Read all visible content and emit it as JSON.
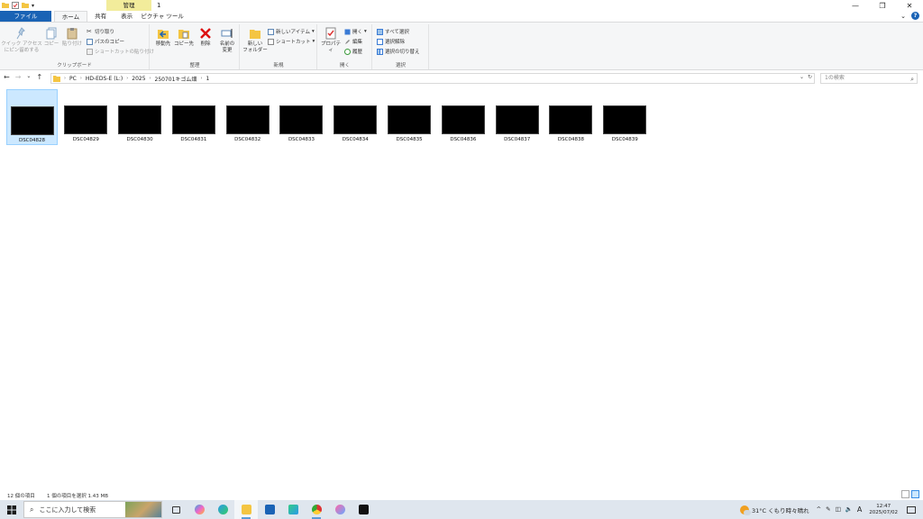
{
  "window": {
    "title": "1",
    "context_tab": "管理",
    "controls": [
      "—",
      "❐",
      "✕"
    ]
  },
  "tabs": {
    "file": "ファイル",
    "home": "ホーム",
    "share": "共有",
    "view": "表示",
    "picture_tools": "ピクチャ ツール"
  },
  "ribbon": {
    "clipboard": {
      "label": "クリップボード",
      "pin": "クイック アクセス\nにピン留めする",
      "copy": "コピー",
      "paste": "貼り付け",
      "cut": "切り取り",
      "copy_path": "パスのコピー",
      "paste_shortcut": "ショートカットの貼り付け"
    },
    "organize": {
      "label": "整理",
      "move_to": "移動先",
      "copy_to": "コピー先",
      "delete": "削除",
      "rename": "名前の\n変更"
    },
    "new": {
      "label": "新規",
      "new_folder": "新しい\nフォルダー",
      "new_item": "新しいアイテム",
      "shortcut": "ショートカット"
    },
    "open": {
      "label": "開く",
      "properties": "プロパティ",
      "open": "開く",
      "edit": "編集",
      "history": "履歴"
    },
    "select": {
      "label": "選択",
      "select_all": "すべて選択",
      "select_none": "選択解除",
      "invert": "選択の切り替え"
    }
  },
  "address": {
    "crumbs": [
      "PC",
      "HD-EDS-E (L:)",
      "2025",
      "250701キゴム畑",
      "1"
    ],
    "search_placeholder": "1の検索"
  },
  "files": [
    {
      "name": "DSC04828",
      "selected": true
    },
    {
      "name": "DSC04829",
      "selected": false
    },
    {
      "name": "DSC04830",
      "selected": false
    },
    {
      "name": "DSC04831",
      "selected": false
    },
    {
      "name": "DSC04832",
      "selected": false
    },
    {
      "name": "DSC04833",
      "selected": false
    },
    {
      "name": "DSC04834",
      "selected": false
    },
    {
      "name": "DSC04835",
      "selected": false
    },
    {
      "name": "DSC04836",
      "selected": false
    },
    {
      "name": "DSC04837",
      "selected": false
    },
    {
      "name": "DSC04838",
      "selected": false
    },
    {
      "name": "DSC04839",
      "selected": false
    }
  ],
  "status": {
    "count": "12 個の項目",
    "selection": "1 個の項目を選択  1.43 MB"
  },
  "taskbar": {
    "search_placeholder": "ここに入力して検索",
    "weather": "31°C  くもり時々晴れ",
    "ime": "A",
    "time": "12:47",
    "date": "2025/07/02"
  }
}
